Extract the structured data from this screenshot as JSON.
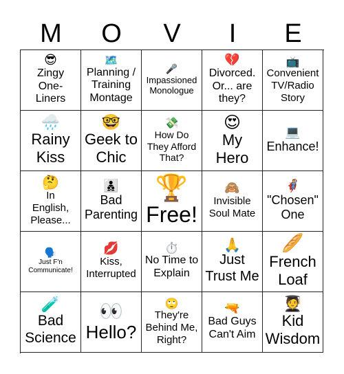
{
  "header": {
    "letters": [
      "M",
      "O",
      "V",
      "I",
      "E"
    ]
  },
  "cells": [
    {
      "icon": "smiling-face-with-sunglasses",
      "emoji": "😎",
      "text": "Zingy One-Liners"
    },
    {
      "icon": "world-map",
      "emoji": "🗺️",
      "text": "Planning / Training Montage"
    },
    {
      "icon": "microphone",
      "emoji": "🎤",
      "text": "Impassioned Monologue"
    },
    {
      "icon": "broken-heart",
      "emoji": "💔",
      "text": "Divorced. Or... are they?"
    },
    {
      "icon": "television",
      "emoji": "📺",
      "text": "Convenient TV/Radio Story"
    },
    {
      "icon": "cloud-with-rain",
      "emoji": "🌧️",
      "text": "Rainy Kiss"
    },
    {
      "icon": "nerd-face",
      "emoji": "🤓",
      "text": "Geek to Chic"
    },
    {
      "icon": "money-with-wings",
      "emoji": "💸",
      "text": "How Do They Afford That?"
    },
    {
      "icon": "heart-eyes-face",
      "emoji": "😍",
      "text": "My Hero"
    },
    {
      "icon": "laptop",
      "emoji": "💻",
      "text": "Enhance!"
    },
    {
      "icon": "thinking-face",
      "emoji": "🤔",
      "text": "In English, Please..."
    },
    {
      "icon": "family-man-boys",
      "emoji": "👨‍👦‍👦",
      "text": "Bad Parenting"
    },
    {
      "icon": "trophy",
      "emoji": "🏆",
      "text": "Free!"
    },
    {
      "icon": "see-no-evil-monkey",
      "emoji": "🙈",
      "text": "Invisible Soul Mate"
    },
    {
      "icon": "superhero",
      "emoji": "🦸",
      "text": "\"Chosen\" One"
    },
    {
      "icon": "speaking-head",
      "emoji": "🗣️",
      "text": "Just F'n Communicate!"
    },
    {
      "icon": "kiss-mark",
      "emoji": "💋",
      "text": "Kiss, Interrupted"
    },
    {
      "icon": "stopwatch",
      "emoji": "⏱️",
      "text": "No Time to Explain"
    },
    {
      "icon": "folded-hands",
      "emoji": "🙏",
      "text": "Just Trust Me"
    },
    {
      "icon": "baguette",
      "emoji": "🥖",
      "text": "French Loaf"
    },
    {
      "icon": "test-tube",
      "emoji": "🧪",
      "text": "Bad Science"
    },
    {
      "icon": "eyes",
      "emoji": "👀",
      "text": "Hello?"
    },
    {
      "icon": "face-with-rolling-eyes",
      "emoji": "🙄",
      "text": "They're Behind Me, Right?"
    },
    {
      "icon": "water-pistol",
      "emoji": "🔫",
      "text": "Bad Guys Can't Aim"
    },
    {
      "icon": "student",
      "emoji": "🧑‍🎓",
      "text": "Kid Wisdom"
    }
  ]
}
